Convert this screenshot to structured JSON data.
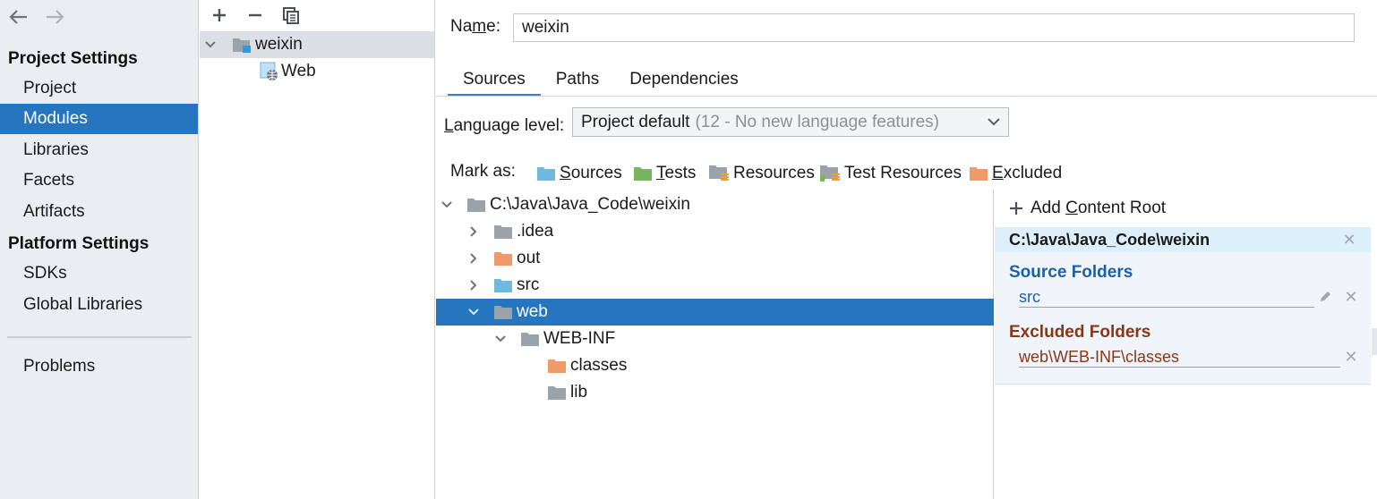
{
  "nav": {
    "back_icon": "arrow-left-icon",
    "forward_icon": "arrow-right-icon"
  },
  "sidebar": {
    "project_settings_heading": "Project Settings",
    "platform_settings_heading": "Platform Settings",
    "items": [
      {
        "label": "Project"
      },
      {
        "label": "Modules"
      },
      {
        "label": "Libraries"
      },
      {
        "label": "Facets"
      },
      {
        "label": "Artifacts"
      },
      {
        "label": "SDKs"
      },
      {
        "label": "Global Libraries"
      },
      {
        "label": "Problems"
      }
    ],
    "selected": "Modules"
  },
  "module_tree": {
    "toolbar": {
      "add_icon": "plus-icon",
      "remove_icon": "minus-icon",
      "copy_icon": "copy-icon"
    },
    "nodes": [
      {
        "label": "weixin",
        "icon": "module-folder-icon"
      },
      {
        "label": "Web",
        "icon": "web-facet-icon"
      }
    ]
  },
  "module": {
    "name_label_pre": "Na",
    "name_label_mnemonic": "m",
    "name_label_post": "e:",
    "name_value": "weixin",
    "tabs": [
      {
        "label": "Sources"
      },
      {
        "label": "Paths"
      },
      {
        "label": "Dependencies"
      }
    ],
    "active_tab": "Sources",
    "language_level_mnemonic": "L",
    "language_level_rest": "anguage level:",
    "language_level_value": "Project default",
    "language_level_hint": "(12 - No new language features)",
    "mark_as_label": "Mark as:",
    "mark_as": [
      {
        "mnemonic": "S",
        "rest": "ources",
        "color": "#6fb8de"
      },
      {
        "mnemonic": "T",
        "rest": "ests",
        "color": "#76b65e"
      },
      {
        "mnemonic": "",
        "rest": "Resources",
        "color": "#9aa2aa"
      },
      {
        "mnemonic": "",
        "rest": "Test Resources",
        "color": "#9aa2aa"
      },
      {
        "mnemonic": "E",
        "rest": "xcluded",
        "color": "#ee9a69"
      }
    ]
  },
  "folder_tree": [
    {
      "label": "C:\\Java\\Java_Code\\weixin",
      "color": "#9aa2aa"
    },
    {
      "label": ".idea",
      "color": "#9aa2aa"
    },
    {
      "label": "out",
      "color": "#ee9a69"
    },
    {
      "label": "src",
      "color": "#6fb8de"
    },
    {
      "label": "web",
      "color": "#9aa2aa"
    },
    {
      "label": "WEB-INF",
      "color": "#9aa2aa"
    },
    {
      "label": "classes",
      "color": "#ee9a69"
    },
    {
      "label": "lib",
      "color": "#9aa2aa"
    }
  ],
  "content_root": {
    "add_pre": "Add ",
    "add_mnemonic": "C",
    "add_post": "ontent Root",
    "root_path": "C:\\Java\\Java_Code\\weixin",
    "source_folders_title": "Source Folders",
    "source_folders": [
      "src"
    ],
    "excluded_folders_title": "Excluded Folders",
    "excluded_folders": [
      "web\\WEB-INF\\classes"
    ],
    "source_color": "#1d5fa8",
    "excluded_color": "#8a3614"
  }
}
